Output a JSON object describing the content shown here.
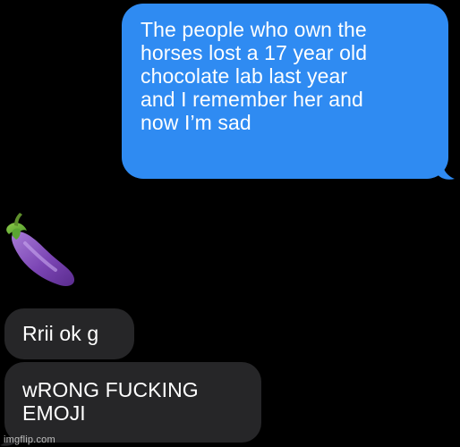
{
  "conversation": {
    "messages": [
      {
        "sender": "me",
        "text": "The people who own the\nhorses lost a 17 year old\nchocolate lab last year\nand I remember her and\nnow I’m sad",
        "color": "#2f8bf2"
      },
      {
        "sender": "them",
        "type": "emoji",
        "emoji": "eggplant-emoji"
      },
      {
        "sender": "them",
        "text": "Rrii ok g",
        "color": "#262628"
      },
      {
        "sender": "them",
        "text": "wRONG FUCKING\nEMOJI",
        "color": "#262628"
      }
    ]
  },
  "watermark": {
    "text": "imgflip.com"
  },
  "colors": {
    "background": "#000000",
    "outgoing_bubble": "#2f8bf2",
    "incoming_bubble": "#262628",
    "text": "#ffffff"
  }
}
